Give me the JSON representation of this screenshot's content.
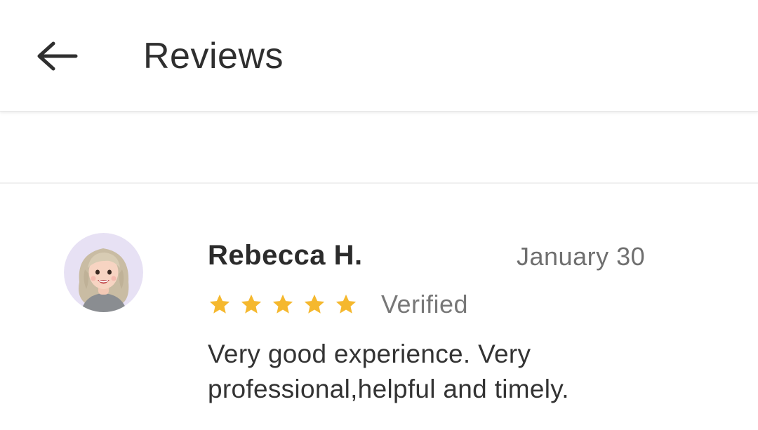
{
  "header": {
    "title": "Reviews",
    "back_icon": "arrow-left-icon"
  },
  "review": {
    "reviewer_name": "Rebecca H.",
    "date": "January 30",
    "rating": 5,
    "max_rating": 5,
    "status": "Verified",
    "text": "Very good experience.  Very\nprofessional,helpful and timely.",
    "avatar_icon": "avatar-cartoon-woman-icon"
  },
  "colors": {
    "star": "#F5B82E",
    "avatar_background": "#E7E1F4",
    "text_primary": "#2E2E2E",
    "text_secondary": "#6F6F6F"
  }
}
